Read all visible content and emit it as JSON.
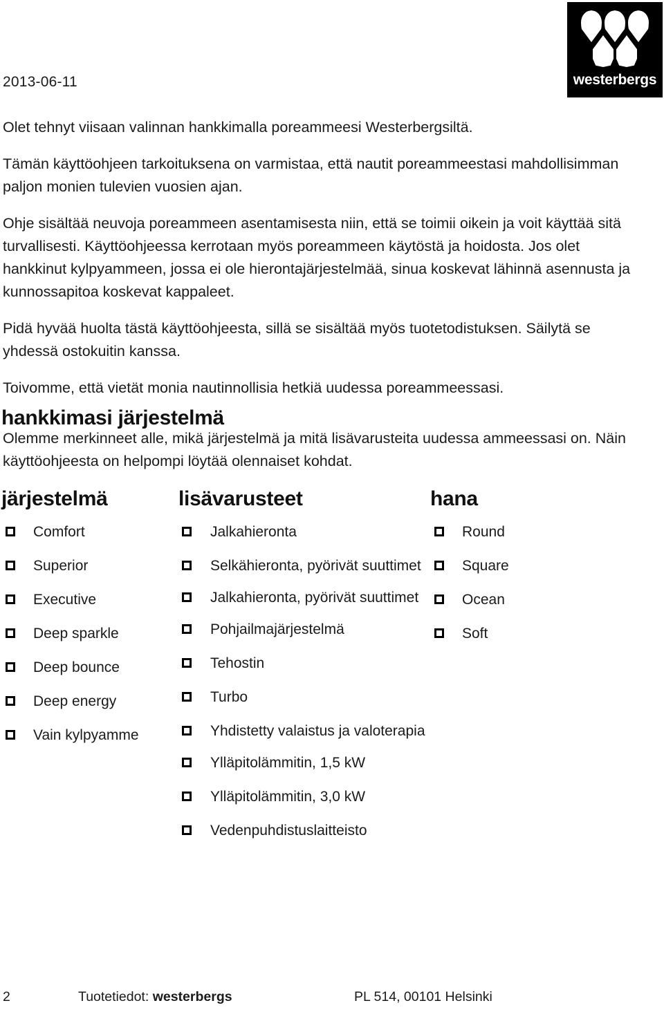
{
  "header": {
    "date": "2013-06-11",
    "logo": {
      "wordmark": "westerbergs",
      "background_color": "#000000",
      "mark_color": "#ffffff",
      "drop_count": 5
    }
  },
  "intro": {
    "paragraphs": [
      "Olet tehnyt viisaan valinnan hankkimalla poreammeesi Westerbergsiltä.",
      "Tämän käyttöohjeen tarkoituksena on varmistaa, että nautit poreammeestasi mahdollisimman paljon monien tulevien vuosien ajan.",
      "Ohje sisältää neuvoja poreammeen asentamisesta niin, että se toimii oikein ja voit käyttää sitä turvallisesti. Käyttöohjeessa kerrotaan myös poreammeen käytöstä ja hoidosta. Jos olet hankkinut kylpyammeen, jossa ei ole hierontajärjestelmää, sinua koskevat lähinnä asennusta ja kunnossapitoa koskevat kappaleet.",
      "Pidä hyvää huolta tästä käyttöohjeesta, sillä se sisältää myös tuotetodistuksen. Säilytä se yhdessä ostokuitin kanssa.",
      "Toivomme, että vietät monia nautinnollisia hetkiä uudessa poreammeessasi."
    ]
  },
  "section": {
    "title": "hankkimasi järjestelmä",
    "body": "Olemme merkinneet alle, mikä järjestelmä ja mitä lisävarusteita uudessa ammeessasi on. Näin käyttöohjeesta on helpompi löytää olennaiset kohdat."
  },
  "columns": [
    {
      "title": "järjestelmä",
      "items": [
        "Comfort",
        "Superior",
        "Executive",
        "Deep sparkle",
        "Deep bounce",
        "Deep energy",
        "Vain kylpyamme"
      ]
    },
    {
      "title": "lisävarusteet",
      "items": [
        "Jalkahieronta",
        "Selkähieronta, pyörivät suuttimet",
        "Jalkahieronta, pyörivät suuttimet",
        "Pohjailmajärjestelmä",
        "Tehostin",
        "Turbo",
        "Yhdistetty valaistus ja valoterapia",
        "Ylläpitolämmitin, 1,5 kW",
        "Ylläpitolämmitin, 3,0 kW",
        "Vedenpuhdistuslaitteisto"
      ]
    },
    {
      "title": "hana",
      "items": [
        "Round",
        "Square",
        "Ocean",
        "Soft"
      ]
    }
  ],
  "footer": {
    "page_number": "2",
    "center_prefix": "Tuotetiedot: ",
    "center_brand": "westerbergs",
    "right": "PL 514, 00101 Helsinki"
  }
}
